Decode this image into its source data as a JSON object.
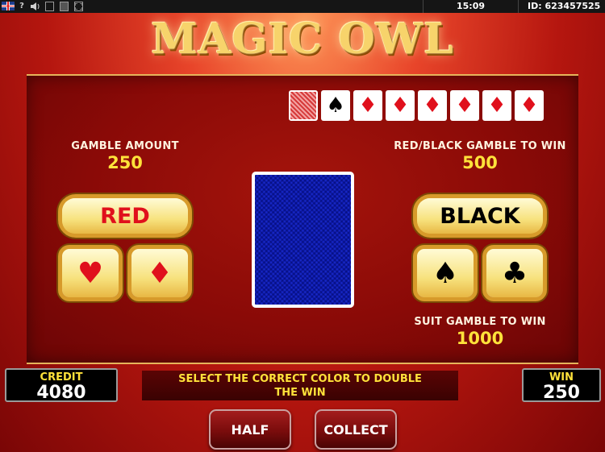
{
  "topbar": {
    "clock": "15:09",
    "session_id": "ID: 623457525",
    "help_icon_text": "?"
  },
  "logo": {
    "title": "MAGIC OWL"
  },
  "history": {
    "cards": [
      {
        "type": "back",
        "glyph": ""
      },
      {
        "type": "black",
        "glyph": "♠"
      },
      {
        "type": "red",
        "glyph": "♦"
      },
      {
        "type": "red",
        "glyph": "♦"
      },
      {
        "type": "red",
        "glyph": "♦"
      },
      {
        "type": "red",
        "glyph": "♦"
      },
      {
        "type": "red",
        "glyph": "♦"
      },
      {
        "type": "red",
        "glyph": "♦"
      }
    ]
  },
  "gamble": {
    "amount_label": "GAMBLE AMOUNT",
    "amount_value": "250",
    "color_win_label": "RED/BLACK GAMBLE TO WIN",
    "color_win_value": "500",
    "suit_win_label": "SUIT GAMBLE TO WIN",
    "suit_win_value": "1000"
  },
  "buttons": {
    "red": "RED",
    "black": "BLACK",
    "hearts": "♥",
    "diamonds": "♦",
    "spades": "♠",
    "clubs": "♣",
    "half": "HALF",
    "collect": "COLLECT"
  },
  "bottom": {
    "credit_label": "CREDIT",
    "credit_value": "4080",
    "message_line1": "SELECT THE CORRECT COLOR TO DOUBLE",
    "message_line2": "THE WIN",
    "win_label": "WIN",
    "win_value": "250"
  },
  "colors": {
    "accent_gold": "#ffe23a",
    "suit_red": "#e0101c",
    "background_red": "#b5160f",
    "card_blue": "#2b3fb8"
  }
}
